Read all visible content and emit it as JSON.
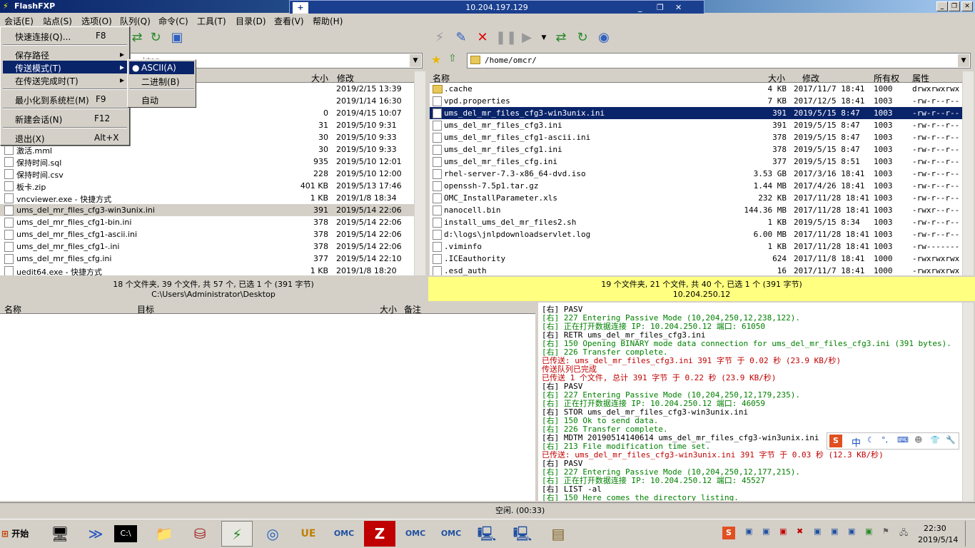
{
  "app": {
    "title": "FlashFXP"
  },
  "rdp": {
    "title": "10.204.197.129"
  },
  "menubar": [
    "会话(E)",
    "站点(S)",
    "选项(O)",
    "队列(Q)",
    "命令(C)",
    "工具(T)",
    "目录(D)",
    "查看(V)",
    "帮助(H)"
  ],
  "session_menu": [
    {
      "label": "快速连接(Q)...",
      "shortcut": "F8"
    },
    {
      "label": "保存路径",
      "arrow": "▸"
    },
    {
      "label": "传送模式(T)",
      "arrow": "▸"
    },
    {
      "label": "在传送完成时(T)",
      "arrow": "▸"
    },
    {
      "label": "最小化到系统栏(M)",
      "shortcut": "F9"
    },
    {
      "label": "新建会话(N)",
      "shortcut": "F12"
    },
    {
      "label": "退出(X)",
      "shortcut": "Alt+X"
    }
  ],
  "transfer_submenu": [
    {
      "label": "ASCII(A)"
    },
    {
      "label": "二进制(B)"
    },
    {
      "label": "自动"
    }
  ],
  "left": {
    "path": "…ktop",
    "cols": {
      "size": "大小",
      "modified": "修改"
    },
    "rows": [
      {
        "name": "",
        "size": "",
        "date": "2019/2/15 13:39"
      },
      {
        "name": "",
        "size": "",
        "date": "2019/1/14 16:30"
      },
      {
        "name": "",
        "size": "0",
        "date": "2019/4/15 10:07"
      },
      {
        "name": "",
        "size": "31",
        "date": "2019/5/10 9:31"
      },
      {
        "name": "",
        "size": "30",
        "date": "2019/5/10 9:33"
      },
      {
        "name": "激活.mml",
        "size": "30",
        "date": "2019/5/10 9:33"
      },
      {
        "name": "保持时间.sql",
        "size": "935",
        "date": "2019/5/10 12:01"
      },
      {
        "name": "保持时间.csv",
        "size": "228",
        "date": "2019/5/10 12:00"
      },
      {
        "name": "板卡.zip",
        "size": "401 KB",
        "date": "2019/5/13 17:46"
      },
      {
        "name": "vncviewer.exe - 快捷方式",
        "size": "1 KB",
        "date": "2019/1/8 18:34"
      },
      {
        "name": "ums_del_mr_files_cfg3-win3unix.ini",
        "size": "391",
        "date": "2019/5/14 22:06"
      },
      {
        "name": "ums_del_mr_files_cfg1-bin.ini",
        "size": "378",
        "date": "2019/5/14 22:06"
      },
      {
        "name": "ums_del_mr_files_cfg1-ascii.ini",
        "size": "378",
        "date": "2019/5/14 22:06"
      },
      {
        "name": "ums_del_mr_files_cfg1-.ini",
        "size": "378",
        "date": "2019/5/14 22:06"
      },
      {
        "name": "ums_del_mr_files_cfg.ini",
        "size": "377",
        "date": "2019/5/14 22:10"
      },
      {
        "name": "uedit64.exe - 快捷方式",
        "size": "1 KB",
        "date": "2019/1/8 18:20"
      }
    ],
    "status1": "18 个文件夹, 39 个文件, 共 57 个, 已选 1 个 (391 字节)",
    "status2": "C:\\Users\\Administrator\\Desktop"
  },
  "right": {
    "path": "/home/omcr/",
    "cols": {
      "name": "名称",
      "size": "大小",
      "modified": "修改",
      "owner": "所有权",
      "attr": "属性"
    },
    "rows": [
      {
        "name": ".cache",
        "size": "4 KB",
        "date": "2017/11/7 18:41",
        "owner": "1000",
        "attr": "drwxrwxrwx",
        "dir": true
      },
      {
        "name": "vpd.properties",
        "size": "7 KB",
        "date": "2017/12/5 18:41",
        "owner": "1003",
        "attr": "-rw-r--r--"
      },
      {
        "name": "ums_del_mr_files_cfg3-win3unix.ini",
        "size": "391",
        "date": "2019/5/15 8:47",
        "owner": "1003",
        "attr": "-rw-r--r--",
        "sel": true
      },
      {
        "name": "ums_del_mr_files_cfg3.ini",
        "size": "391",
        "date": "2019/5/15 8:47",
        "owner": "1003",
        "attr": "-rw-r--r--"
      },
      {
        "name": "ums_del_mr_files_cfg1-ascii.ini",
        "size": "378",
        "date": "2019/5/15 8:47",
        "owner": "1003",
        "attr": "-rw-r--r--"
      },
      {
        "name": "ums_del_mr_files_cfg1.ini",
        "size": "378",
        "date": "2019/5/15 8:47",
        "owner": "1003",
        "attr": "-rw-r--r--"
      },
      {
        "name": "ums_del_mr_files_cfg.ini",
        "size": "377",
        "date": "2019/5/15 8:51",
        "owner": "1003",
        "attr": "-rw-r--r--"
      },
      {
        "name": "rhel-server-7.3-x86_64-dvd.iso",
        "size": "3.53 GB",
        "date": "2017/3/16 18:41",
        "owner": "1003",
        "attr": "-rw-r--r--"
      },
      {
        "name": "openssh-7.5p1.tar.gz",
        "size": "1.44 MB",
        "date": "2017/4/26 18:41",
        "owner": "1003",
        "attr": "-rw-r--r--"
      },
      {
        "name": "OMC_InstallParameter.xls",
        "size": "232 KB",
        "date": "2017/11/28 18:41",
        "owner": "1003",
        "attr": "-rw-r--r--"
      },
      {
        "name": "nanocell.bin",
        "size": "144.36 MB",
        "date": "2017/11/28 18:41",
        "owner": "1003",
        "attr": "-rwxr--r--"
      },
      {
        "name": "install_ums_del_mr_files2.sh",
        "size": "1 KB",
        "date": "2019/5/15 8:34",
        "owner": "1003",
        "attr": "-rw-r--r--"
      },
      {
        "name": "d:\\logs\\jnlpdownloadservlet.log",
        "size": "6.00 MB",
        "date": "2017/11/28 18:41",
        "owner": "1003",
        "attr": "-rw-r--r--"
      },
      {
        "name": ".viminfo",
        "size": "1 KB",
        "date": "2017/11/28 18:41",
        "owner": "1003",
        "attr": "-rw-------"
      },
      {
        "name": ".ICEauthority",
        "size": "624",
        "date": "2017/11/8 18:41",
        "owner": "1000",
        "attr": "-rwxrwxrwx"
      },
      {
        "name": ".esd_auth",
        "size": "16",
        "date": "2017/11/7 18:41",
        "owner": "1000",
        "attr": "-rwxrwxrwx"
      }
    ],
    "status1": "19 个文件夹, 21 个文件, 共 40 个, 已选 1 个 (391 字节)",
    "status2": "10.204.250.12"
  },
  "queue": {
    "cols": [
      "名称",
      "目标",
      "大小",
      "备注"
    ]
  },
  "log": [
    {
      "t": "[右] PASV",
      "c": "blk"
    },
    {
      "t": "[右] 227 Entering Passive Mode (10,204,250,12,238,122).",
      "c": "grn"
    },
    {
      "t": "[右] 正在打开数据连接 IP: 10.204.250.12 端口: 61050",
      "c": "grn"
    },
    {
      "t": "[右] RETR ums_del_mr_files_cfg3.ini",
      "c": "blk"
    },
    {
      "t": "[右] 150 Opening BINARY mode data connection for ums_del_mr_files_cfg3.ini (391 bytes).",
      "c": "grn"
    },
    {
      "t": "[右] 226 Transfer complete.",
      "c": "grn"
    },
    {
      "t": "已传送: ums_del_mr_files_cfg3.ini 391 字节 于 0.02 秒 (23.9 KB/秒)",
      "c": "red"
    },
    {
      "t": "传送队列已完成",
      "c": "red"
    },
    {
      "t": "已传送 1 个文件, 总计 391 字节 于 0.22 秒 (23.9 KB/秒)",
      "c": "red"
    },
    {
      "t": "[右] PASV",
      "c": "blk"
    },
    {
      "t": "[右] 227 Entering Passive Mode (10,204,250,12,179,235).",
      "c": "grn"
    },
    {
      "t": "[右] 正在打开数据连接 IP: 10.204.250.12 端口: 46059",
      "c": "grn"
    },
    {
      "t": "[右] STOR ums_del_mr_files_cfg3-win3unix.ini",
      "c": "blk"
    },
    {
      "t": "[右] 150 Ok to send data.",
      "c": "grn"
    },
    {
      "t": "[右] 226 Transfer complete.",
      "c": "grn"
    },
    {
      "t": "[右] MDTM 20190514140614 ums_del_mr_files_cfg3-win3unix.ini",
      "c": "blk"
    },
    {
      "t": "[右] 213 File modification time set.",
      "c": "grn"
    },
    {
      "t": "已传送: ums_del_mr_files_cfg3-win3unix.ini 391 字节 于 0.03 秒 (12.3 KB/秒)",
      "c": "red"
    },
    {
      "t": "[右] PASV",
      "c": "blk"
    },
    {
      "t": "[右] 227 Entering Passive Mode (10,204,250,12,177,215).",
      "c": "grn"
    },
    {
      "t": "[右] 正在打开数据连接 IP: 10.204.250.12 端口: 45527",
      "c": "grn"
    },
    {
      "t": "[右] LIST -al",
      "c": "blk"
    },
    {
      "t": "[右] 150 Here comes the directory listing.",
      "c": "grn"
    }
  ],
  "status_idle": "空闲. (00:33)",
  "ime": {
    "label": "中"
  },
  "taskbar": {
    "start": "开始",
    "time": "22:30",
    "date": "2019/5/14"
  }
}
